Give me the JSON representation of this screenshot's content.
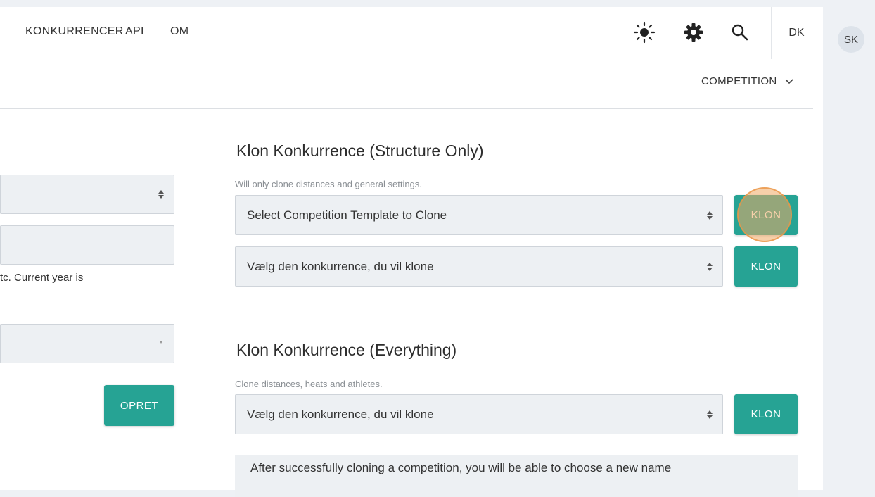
{
  "nav": {
    "links": [
      "KONKURRENCER",
      "API",
      "OM"
    ],
    "lang": "DK",
    "avatar": "SK"
  },
  "context_menu": {
    "label": "COMPETITION"
  },
  "left_panel": {
    "help_text": "tc. Current year is",
    "create_button": "OPRET"
  },
  "structure_section": {
    "title": "Klon Konkurrence (Structure Only)",
    "hint": "Will only clone distances and general settings.",
    "select1_value": "Select Competition Template to Clone",
    "select2_value": "Vælg den konkurrence, du vil klone",
    "clone_button": "KLON"
  },
  "everything_section": {
    "title": "Klon Konkurrence (Everything)",
    "hint": "Clone distances, heats and athletes.",
    "select_value": "Vælg den konkurrence, du vil klone",
    "clone_button": "KLON",
    "info": "After successfully cloning a competition, you will be able to choose a new name"
  },
  "colors": {
    "accent": "#26a394",
    "field_bg": "#edf0f3",
    "page_bg": "#eef1f5",
    "highlight": "#f0aa64"
  }
}
